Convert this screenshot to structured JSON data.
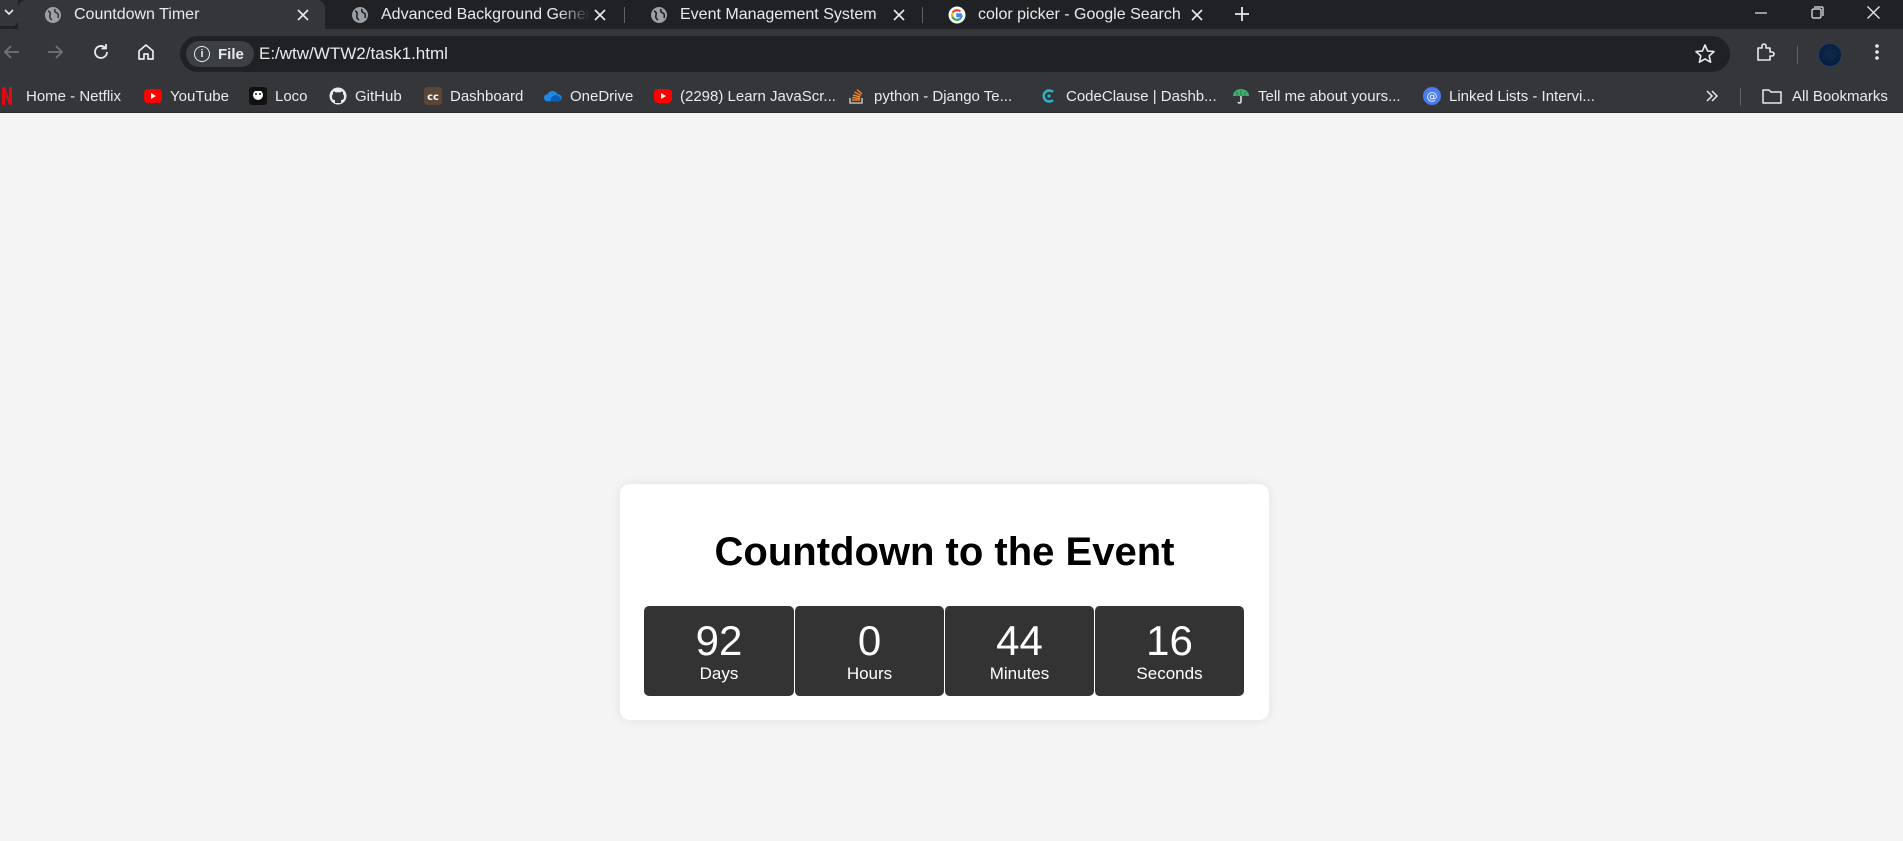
{
  "tabs": [
    {
      "title": "Countdown Timer",
      "active": true,
      "icon": "globe-icon"
    },
    {
      "title": "Advanced Background Generator",
      "active": false,
      "icon": "globe-icon"
    },
    {
      "title": "Event Management System",
      "active": false,
      "icon": "globe-icon"
    },
    {
      "title": "color picker - Google Search",
      "active": false,
      "icon": "google-icon"
    }
  ],
  "toolbar": {
    "chip_label": "File",
    "url": "E:/wtw/WTW2/task1.html"
  },
  "bookmarks": [
    {
      "label": "Home - Netflix",
      "icon": "netflix-icon"
    },
    {
      "label": "YouTube",
      "icon": "youtube-icon"
    },
    {
      "label": "Loco",
      "icon": "loco-icon"
    },
    {
      "label": "GitHub",
      "icon": "github-icon"
    },
    {
      "label": "Dashboard",
      "icon": "codechef-icon"
    },
    {
      "label": "OneDrive",
      "icon": "onedrive-icon"
    },
    {
      "label": "(2298) Learn JavaScr...",
      "icon": "youtube-icon"
    },
    {
      "label": "python - Django Te...",
      "icon": "stackoverflow-icon"
    },
    {
      "label": "CodeClause | Dashb...",
      "icon": "codeclause-icon"
    },
    {
      "label": "Tell me about yours...",
      "icon": "umbrella-icon"
    },
    {
      "label": "Linked Lists - Intervi...",
      "icon": "at-icon"
    }
  ],
  "all_bookmarks_label": "All Bookmarks",
  "countdown": {
    "title": "Countdown to the Event",
    "units": [
      {
        "value": "92",
        "label": "Days"
      },
      {
        "value": "0",
        "label": "Hours"
      },
      {
        "value": "44",
        "label": "Minutes"
      },
      {
        "value": "16",
        "label": "Seconds"
      }
    ]
  },
  "colors": {
    "browser_dark": "#202124",
    "browser_toolbar": "#35363a",
    "page_bg": "#f4f4f4",
    "card_bg": "#ffffff",
    "unit_bg": "#333333"
  }
}
